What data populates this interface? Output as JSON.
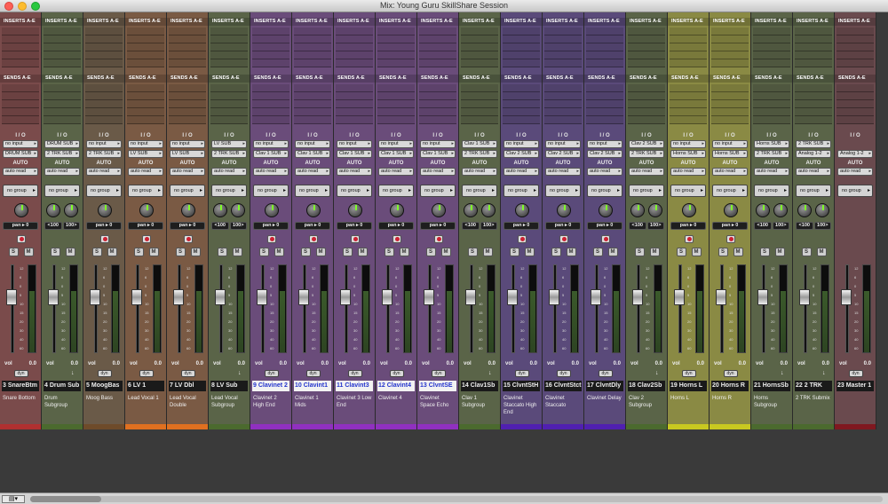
{
  "window": {
    "title": "Mix: Young Guru SkillShare Session"
  },
  "labels": {
    "inserts": "INSERTS A-E",
    "sends": "SENDS A-E",
    "io": "I / O",
    "auto": "AUTO",
    "vol": "vol",
    "dyn": "dyn",
    "solo": "S",
    "mute": "M"
  },
  "strips": [
    {
      "num": "3",
      "name": "SnareBtm",
      "input": "no input",
      "output": "DRUM SUB",
      "automation": "auto read",
      "group": "no group",
      "pan": [
        "pan ▸ 0"
      ],
      "vol": "0.0",
      "comment": "Snare Bottom",
      "color": "#b03030",
      "bg": "#7a4b4b",
      "sel": false
    },
    {
      "num": "4",
      "name": "Drum Sub",
      "input": "DRUM SUB",
      "output": "2 TRK SUB",
      "automation": "auto read",
      "group": "no group",
      "pan": [
        "<100",
        "100>"
      ],
      "vol": "0.0",
      "comment": "Drum Subgroup",
      "color": "#4b6a2e",
      "bg": "#5a6448",
      "sel": false
    },
    {
      "num": "5",
      "name": "MoogBas",
      "input": "no input",
      "output": "2 TRK SUB",
      "automation": "auto read",
      "group": "no group",
      "pan": [
        "pan ▸ 0"
      ],
      "vol": "0.0",
      "comment": "Moog Bass",
      "color": "#6e4b2a",
      "bg": "#6a5a48",
      "sel": false
    },
    {
      "num": "6",
      "name": "LV 1",
      "input": "no input",
      "output": "LV SUB",
      "automation": "auto read",
      "group": "no group",
      "pan": [
        "pan ▸ 0"
      ],
      "vol": "0.0",
      "comment": "Lead Vocal 1",
      "color": "#e07020",
      "bg": "#7a5a44",
      "sel": false
    },
    {
      "num": "7",
      "name": "LV Dbl",
      "input": "no input",
      "output": "LV SUB",
      "automation": "auto read",
      "group": "no group",
      "pan": [
        "pan ▸ 0"
      ],
      "vol": "0.0",
      "comment": "Lead Vocal Double",
      "color": "#e07020",
      "bg": "#7a5a44",
      "sel": false
    },
    {
      "num": "8",
      "name": "LV Sub",
      "input": "LV SUB",
      "output": "2 TRK SUB",
      "automation": "auto read",
      "group": "no group",
      "pan": [
        "<100",
        "100>"
      ],
      "vol": "0.0",
      "comment": "Lead Vocal Subgroup",
      "color": "#4b6a2e",
      "bg": "#5a6448",
      "sel": false
    },
    {
      "num": "9",
      "name": "Clavinet 2",
      "input": "no input",
      "output": "Clav 1 SUB",
      "automation": "auto read",
      "group": "no group",
      "pan": [
        "pan ▸ 0"
      ],
      "vol": "0.0",
      "comment": "Clavinet 2 High End",
      "color": "#9030c0",
      "bg": "#6a4c7a",
      "sel": true
    },
    {
      "num": "10",
      "name": "Clavint1",
      "input": "no input",
      "output": "Clav 1 SUB",
      "automation": "auto read",
      "group": "no group",
      "pan": [
        "pan ▸ 0"
      ],
      "vol": "0.0",
      "comment": "Clavinet 1 Mids",
      "color": "#9030c0",
      "bg": "#6a4c7a",
      "sel": true
    },
    {
      "num": "11",
      "name": "Clavint3",
      "input": "no input",
      "output": "Clav 1 SUB",
      "automation": "auto read",
      "group": "no group",
      "pan": [
        "pan ▸ 0"
      ],
      "vol": "0.0",
      "comment": "Clavinet 3 Low End",
      "color": "#9030c0",
      "bg": "#6a4c7a",
      "sel": true
    },
    {
      "num": "12",
      "name": "Clavint4",
      "input": "no input",
      "output": "Clav 1 SUB",
      "automation": "auto read",
      "group": "no group",
      "pan": [
        "pan ▸ 0"
      ],
      "vol": "0.0",
      "comment": "Clavinet 4",
      "color": "#9030c0",
      "bg": "#6a4c7a",
      "sel": true
    },
    {
      "num": "13",
      "name": "ClvntSE",
      "input": "no input",
      "output": "Clav 1 SUB",
      "automation": "auto read",
      "group": "no group",
      "pan": [
        "pan ▸ 0"
      ],
      "vol": "0.0",
      "comment": "Clavinet Space Echo",
      "color": "#9030c0",
      "bg": "#6a4c7a",
      "sel": true
    },
    {
      "num": "14",
      "name": "Clav1Sb",
      "input": "Clav 1 SUB",
      "output": "2 TRK SUB",
      "automation": "auto read",
      "group": "no group",
      "pan": [
        "<100",
        "100>"
      ],
      "vol": "0.0",
      "comment": "Clav 1 Subgroup",
      "color": "#4b6a2e",
      "bg": "#5a6448",
      "sel": false
    },
    {
      "num": "15",
      "name": "ClvntStH",
      "input": "no input",
      "output": "Clav 2 SUB",
      "automation": "auto read",
      "group": "no group",
      "pan": [
        "pan ▸ 0"
      ],
      "vol": "0.0",
      "comment": "Clavinet Staccato High End",
      "color": "#5020b0",
      "bg": "#5a4a7a",
      "sel": false
    },
    {
      "num": "16",
      "name": "ClvntStct",
      "input": "no input",
      "output": "Clav 2 SUB",
      "automation": "auto read",
      "group": "no group",
      "pan": [
        "pan ▸ 0"
      ],
      "vol": "0.0",
      "comment": "Clavinet Staccato",
      "color": "#5020b0",
      "bg": "#5a4a7a",
      "sel": false
    },
    {
      "num": "17",
      "name": "ClvntDly",
      "input": "no input",
      "output": "Clav 2 SUB",
      "automation": "auto read",
      "group": "no group",
      "pan": [
        "pan ▸ 0"
      ],
      "vol": "0.0",
      "comment": "Clavinet Delay",
      "color": "#5020b0",
      "bg": "#5a4a7a",
      "sel": false
    },
    {
      "num": "18",
      "name": "Clav2Sb",
      "input": "Clav 2 SUB",
      "output": "2 TRK SUB",
      "automation": "auto read",
      "group": "no group",
      "pan": [
        "<100",
        "100>"
      ],
      "vol": "0.0",
      "comment": "Clav 2 Subgroup",
      "color": "#4b6a2e",
      "bg": "#5a6448",
      "sel": false
    },
    {
      "num": "19",
      "name": "Horns L",
      "input": "no input",
      "output": "Horns SUB",
      "automation": "auto read",
      "group": "no group",
      "pan": [
        "pan ▸ 0"
      ],
      "vol": "0.0",
      "comment": "Horns L",
      "color": "#c8c820",
      "bg": "#8a8a44",
      "sel": false
    },
    {
      "num": "20",
      "name": "Horns R",
      "input": "no input",
      "output": "Horns SUB",
      "automation": "auto read",
      "group": "no group",
      "pan": [
        "pan ▸ 0"
      ],
      "vol": "0.0",
      "comment": "Horns R",
      "color": "#c8c820",
      "bg": "#8a8a44",
      "sel": false
    },
    {
      "num": "21",
      "name": "HornsSb",
      "input": "Horns SUB",
      "output": "2 TRK SUB",
      "automation": "auto read",
      "group": "no group",
      "pan": [
        "<100",
        "100>"
      ],
      "vol": "0.0",
      "comment": "Horns Subgroup",
      "color": "#4b6a2e",
      "bg": "#5a6448",
      "sel": false
    },
    {
      "num": "22",
      "name": "2 TRK",
      "input": "2 TRK SUB",
      "output": "Analog 1-2",
      "automation": "auto read",
      "group": "no group",
      "pan": [
        "<100",
        "100>"
      ],
      "vol": "0.0",
      "comment": "2 TRK Submix",
      "color": "#4b6a2e",
      "bg": "#5a6448",
      "sel": false
    },
    {
      "num": "23",
      "name": "Master 1",
      "input": "",
      "output": "Analog 1-2",
      "automation": "auto read",
      "group": "no group",
      "pan": [],
      "vol": "0.0",
      "comment": "",
      "color": "#801820",
      "bg": "#6a4a4e",
      "sel": false
    }
  ]
}
